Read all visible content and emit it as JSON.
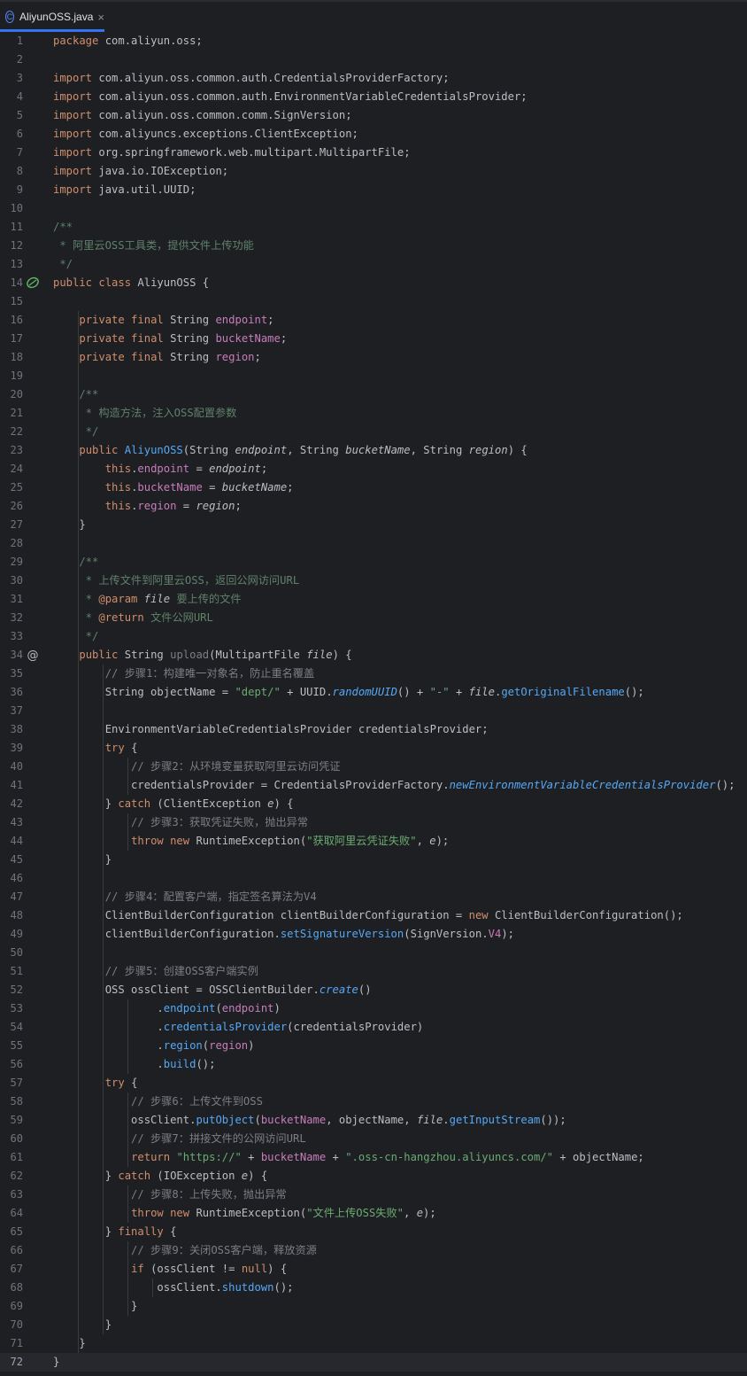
{
  "tab": {
    "file_name": "AliyunOSS.java",
    "icon": "class-icon",
    "close": "×"
  },
  "current_line": 72,
  "lines": [
    [
      [
        "kw",
        "package "
      ],
      [
        "ident",
        "com.aliyun.oss;"
      ]
    ],
    [],
    [
      [
        "kw",
        "import "
      ],
      [
        "ident",
        "com.aliyun.oss.common.auth.CredentialsProviderFactory;"
      ]
    ],
    [
      [
        "kw",
        "import "
      ],
      [
        "ident",
        "com.aliyun.oss.common.auth.EnvironmentVariableCredentialsProvider;"
      ]
    ],
    [
      [
        "kw",
        "import "
      ],
      [
        "ident",
        "com.aliyun.oss.common.comm.SignVersion;"
      ]
    ],
    [
      [
        "kw",
        "import "
      ],
      [
        "ident",
        "com.aliyuncs.exceptions.ClientException;"
      ]
    ],
    [
      [
        "kw",
        "import "
      ],
      [
        "ident",
        "org.springframework.web.multipart.MultipartFile;"
      ]
    ],
    [
      [
        "kw",
        "import "
      ],
      [
        "ident",
        "java.io.IOException;"
      ]
    ],
    [
      [
        "kw",
        "import "
      ],
      [
        "ident",
        "java.util.UUID;"
      ]
    ],
    [],
    [
      [
        "dc",
        "/**"
      ]
    ],
    [
      [
        "dc",
        " * 阿里云OSS工具类，提供文件上传功能"
      ]
    ],
    [
      [
        "dc",
        " */"
      ]
    ],
    [
      [
        "kw",
        "public class "
      ],
      [
        "ident",
        "AliyunOSS "
      ],
      [
        "ident",
        "{"
      ]
    ],
    [],
    [
      [
        "ident",
        "    "
      ],
      [
        "kw",
        "private final "
      ],
      [
        "ident",
        "String "
      ],
      [
        "fld",
        "endpoint"
      ],
      [
        "ident",
        ";"
      ]
    ],
    [
      [
        "ident",
        "    "
      ],
      [
        "kw",
        "private final "
      ],
      [
        "ident",
        "String "
      ],
      [
        "fld",
        "bucketName"
      ],
      [
        "ident",
        ";"
      ]
    ],
    [
      [
        "ident",
        "    "
      ],
      [
        "kw",
        "private final "
      ],
      [
        "ident",
        "String "
      ],
      [
        "fld",
        "region"
      ],
      [
        "ident",
        ";"
      ]
    ],
    [],
    [
      [
        "dc",
        "    /**"
      ]
    ],
    [
      [
        "dc",
        "     * 构造方法，注入OSS配置参数"
      ]
    ],
    [
      [
        "dc",
        "     */"
      ]
    ],
    [
      [
        "ident",
        "    "
      ],
      [
        "kw",
        "public "
      ],
      [
        "mth",
        "AliyunOSS"
      ],
      [
        "ident",
        "(String "
      ],
      [
        "par",
        "endpoint"
      ],
      [
        "ident",
        ", String "
      ],
      [
        "par",
        "bucketName"
      ],
      [
        "ident",
        ", String "
      ],
      [
        "par",
        "region"
      ],
      [
        "ident",
        ") {"
      ]
    ],
    [
      [
        "ident",
        "        "
      ],
      [
        "kw",
        "this"
      ],
      [
        "ident",
        "."
      ],
      [
        "fld",
        "endpoint"
      ],
      [
        "ident",
        " = "
      ],
      [
        "par",
        "endpoint"
      ],
      [
        "ident",
        ";"
      ]
    ],
    [
      [
        "ident",
        "        "
      ],
      [
        "kw",
        "this"
      ],
      [
        "ident",
        "."
      ],
      [
        "fld",
        "bucketName"
      ],
      [
        "ident",
        " = "
      ],
      [
        "par",
        "bucketName"
      ],
      [
        "ident",
        ";"
      ]
    ],
    [
      [
        "ident",
        "        "
      ],
      [
        "kw",
        "this"
      ],
      [
        "ident",
        "."
      ],
      [
        "fld",
        "region"
      ],
      [
        "ident",
        " = "
      ],
      [
        "par",
        "region"
      ],
      [
        "ident",
        ";"
      ]
    ],
    [
      [
        "ident",
        "    }"
      ]
    ],
    [],
    [
      [
        "dc",
        "    /**"
      ]
    ],
    [
      [
        "dc",
        "     * 上传文件到阿里云OSS，返回公网访问URL"
      ]
    ],
    [
      [
        "dc",
        "     * "
      ],
      [
        "kw",
        "@param "
      ],
      [
        "par",
        "file"
      ],
      [
        "dc",
        " 要上传的文件"
      ]
    ],
    [
      [
        "dc",
        "     * "
      ],
      [
        "kw",
        "@return"
      ],
      [
        "dc",
        " 文件公网URL"
      ]
    ],
    [
      [
        "dc",
        "     */"
      ]
    ],
    [
      [
        "ident",
        "    "
      ],
      [
        "kw",
        "public "
      ],
      [
        "ident",
        "String "
      ],
      [
        "cmt",
        "upload"
      ],
      [
        "ident",
        "(MultipartFile "
      ],
      [
        "par",
        "file"
      ],
      [
        "ident",
        ") {"
      ]
    ],
    [
      [
        "cmt",
        "        // 步骤1：构建唯一对象名，防止重名覆盖"
      ]
    ],
    [
      [
        "ident",
        "        String objectName = "
      ],
      [
        "str",
        "\"dept/\""
      ],
      [
        "ident",
        " + UUID."
      ],
      [
        "static",
        "randomUUID"
      ],
      [
        "ident",
        "() + "
      ],
      [
        "str",
        "\"-\""
      ],
      [
        "ident",
        " + "
      ],
      [
        "par",
        "file"
      ],
      [
        "ident",
        "."
      ],
      [
        "mth",
        "getOriginalFilename"
      ],
      [
        "ident",
        "();"
      ]
    ],
    [],
    [
      [
        "ident",
        "        EnvironmentVariableCredentialsProvider credentialsProvider;"
      ]
    ],
    [
      [
        "ident",
        "        "
      ],
      [
        "kw",
        "try "
      ],
      [
        "ident",
        "{"
      ]
    ],
    [
      [
        "cmt",
        "            // 步骤2：从环境变量获取阿里云访问凭证"
      ]
    ],
    [
      [
        "ident",
        "            credentialsProvider = CredentialsProviderFactory."
      ],
      [
        "static",
        "newEnvironmentVariableCredentialsProvider"
      ],
      [
        "ident",
        "();"
      ]
    ],
    [
      [
        "ident",
        "        } "
      ],
      [
        "kw",
        "catch "
      ],
      [
        "ident",
        "(ClientException "
      ],
      [
        "par",
        "e"
      ],
      [
        "ident",
        ") {"
      ]
    ],
    [
      [
        "cmt",
        "            // 步骤3：获取凭证失败，抛出异常"
      ]
    ],
    [
      [
        "ident",
        "            "
      ],
      [
        "kw",
        "throw new "
      ],
      [
        "ident",
        "RuntimeException("
      ],
      [
        "str",
        "\"获取阿里云凭证失败\""
      ],
      [
        "ident",
        ", "
      ],
      [
        "par",
        "e"
      ],
      [
        "ident",
        ");"
      ]
    ],
    [
      [
        "ident",
        "        }"
      ]
    ],
    [],
    [
      [
        "cmt",
        "        // 步骤4：配置客户端，指定签名算法为V4"
      ]
    ],
    [
      [
        "ident",
        "        ClientBuilderConfiguration clientBuilderConfiguration = "
      ],
      [
        "kw",
        "new "
      ],
      [
        "ident",
        "ClientBuilderConfiguration();"
      ]
    ],
    [
      [
        "ident",
        "        clientBuilderConfiguration."
      ],
      [
        "mth",
        "setSignatureVersion"
      ],
      [
        "ident",
        "(SignVersion."
      ],
      [
        "fld",
        "V4"
      ],
      [
        "ident",
        ");"
      ]
    ],
    [],
    [
      [
        "cmt",
        "        // 步骤5：创建OSS客户端实例"
      ]
    ],
    [
      [
        "ident",
        "        OSS ossClient = OSSClientBuilder."
      ],
      [
        "static",
        "create"
      ],
      [
        "ident",
        "()"
      ]
    ],
    [
      [
        "ident",
        "                ."
      ],
      [
        "mth",
        "endpoint"
      ],
      [
        "ident",
        "("
      ],
      [
        "fld",
        "endpoint"
      ],
      [
        "ident",
        ")"
      ]
    ],
    [
      [
        "ident",
        "                ."
      ],
      [
        "mth",
        "credentialsProvider"
      ],
      [
        "ident",
        "(credentialsProvider)"
      ]
    ],
    [
      [
        "ident",
        "                ."
      ],
      [
        "mth",
        "region"
      ],
      [
        "ident",
        "("
      ],
      [
        "fld",
        "region"
      ],
      [
        "ident",
        ")"
      ]
    ],
    [
      [
        "ident",
        "                ."
      ],
      [
        "mth",
        "build"
      ],
      [
        "ident",
        "();"
      ]
    ],
    [
      [
        "ident",
        "        "
      ],
      [
        "kw",
        "try "
      ],
      [
        "ident",
        "{"
      ]
    ],
    [
      [
        "cmt",
        "            // 步骤6：上传文件到OSS"
      ]
    ],
    [
      [
        "ident",
        "            ossClient."
      ],
      [
        "mth",
        "putObject"
      ],
      [
        "ident",
        "("
      ],
      [
        "fld",
        "bucketName"
      ],
      [
        "ident",
        ", objectName, "
      ],
      [
        "par",
        "file"
      ],
      [
        "ident",
        "."
      ],
      [
        "mth",
        "getInputStream"
      ],
      [
        "ident",
        "());"
      ]
    ],
    [
      [
        "cmt",
        "            // 步骤7：拼接文件的公网访问URL"
      ]
    ],
    [
      [
        "ident",
        "            "
      ],
      [
        "kw",
        "return "
      ],
      [
        "str",
        "\"https://\""
      ],
      [
        "ident",
        " + "
      ],
      [
        "fld",
        "bucketName"
      ],
      [
        "ident",
        " + "
      ],
      [
        "str",
        "\".oss-cn-hangzhou.aliyuncs.com/\""
      ],
      [
        "ident",
        " + objectName;"
      ]
    ],
    [
      [
        "ident",
        "        } "
      ],
      [
        "kw",
        "catch "
      ],
      [
        "ident",
        "(IOException "
      ],
      [
        "par",
        "e"
      ],
      [
        "ident",
        ") {"
      ]
    ],
    [
      [
        "cmt",
        "            // 步骤8：上传失败，抛出异常"
      ]
    ],
    [
      [
        "ident",
        "            "
      ],
      [
        "kw",
        "throw new "
      ],
      [
        "ident",
        "RuntimeException("
      ],
      [
        "str",
        "\"文件上传OSS失败\""
      ],
      [
        "ident",
        ", "
      ],
      [
        "par",
        "e"
      ],
      [
        "ident",
        ");"
      ]
    ],
    [
      [
        "ident",
        "        } "
      ],
      [
        "kw",
        "finally "
      ],
      [
        "ident",
        "{"
      ]
    ],
    [
      [
        "cmt",
        "            // 步骤9：关闭OSS客户端，释放资源"
      ]
    ],
    [
      [
        "ident",
        "            "
      ],
      [
        "kw",
        "if "
      ],
      [
        "ident",
        "(ossClient != "
      ],
      [
        "kw",
        "null"
      ],
      [
        "ident",
        ") {"
      ]
    ],
    [
      [
        "ident",
        "                ossClient."
      ],
      [
        "mth",
        "shutdown"
      ],
      [
        "ident",
        "();"
      ]
    ],
    [
      [
        "ident",
        "            }"
      ]
    ],
    [
      [
        "ident",
        "        }"
      ]
    ],
    [
      [
        "ident",
        "    }"
      ]
    ],
    [
      [
        "ident",
        "}"
      ]
    ]
  ],
  "gutter_marks": [
    {
      "line": 14,
      "icon": "bean-icon"
    },
    {
      "line": 34,
      "icon": "at-icon"
    }
  ]
}
